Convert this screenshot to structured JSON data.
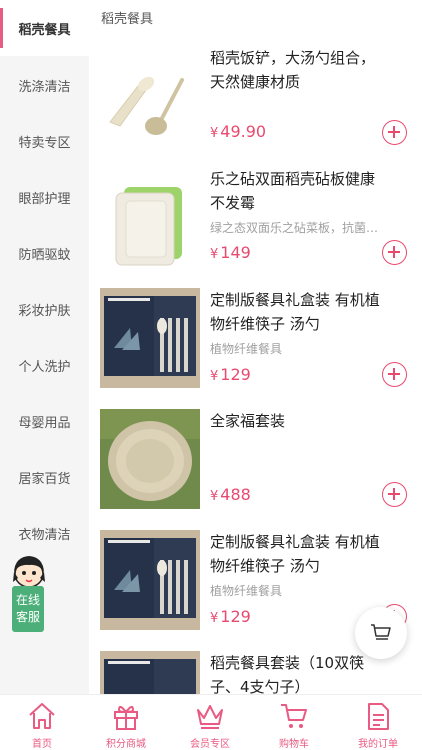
{
  "sidebar": {
    "items": [
      {
        "label": "稻壳餐具",
        "active": true
      },
      {
        "label": "洗涤清洁"
      },
      {
        "label": "特卖专区"
      },
      {
        "label": "眼部护理"
      },
      {
        "label": "防晒驱蚊"
      },
      {
        "label": "彩妆护肤"
      },
      {
        "label": "个人洗护"
      },
      {
        "label": "母婴用品"
      },
      {
        "label": "居家百货"
      },
      {
        "label": "衣物清洁"
      }
    ]
  },
  "service": {
    "label": "在线客服"
  },
  "main": {
    "section_title": "稻壳餐具",
    "currency": "¥",
    "products": [
      {
        "name": "稻壳饭铲，大汤勺组合，天然健康材质",
        "desc": "",
        "price": "49.90"
      },
      {
        "name": "乐之砧双面稻壳砧板健康不发霉",
        "desc": "绿之态双面乐之砧菜板，抗菌防霉",
        "price": "149"
      },
      {
        "name": "定制版餐具礼盒装 有机植物纤维筷子 汤勺",
        "desc": "植物纤维餐具",
        "price": "129"
      },
      {
        "name": "全家福套装",
        "desc": "",
        "price": "488"
      },
      {
        "name": "定制版餐具礼盒装 有机植物纤维筷子 汤勺",
        "desc": "植物纤维餐具",
        "price": "129"
      },
      {
        "name": "稻壳餐具套装（10双筷子、4支勺子）",
        "desc": "",
        "price": ""
      }
    ]
  },
  "bottom_nav": [
    {
      "label": "首页",
      "icon": "home-icon"
    },
    {
      "label": "积分商城",
      "icon": "gift-icon"
    },
    {
      "label": "会员专区",
      "icon": "crown-icon"
    },
    {
      "label": "购物车",
      "icon": "cart-icon"
    },
    {
      "label": "我的订单",
      "icon": "order-icon"
    }
  ],
  "colors": {
    "accent": "#e84a6f",
    "service": "#4caf79",
    "sidebar_bg": "#f5f5f5"
  }
}
